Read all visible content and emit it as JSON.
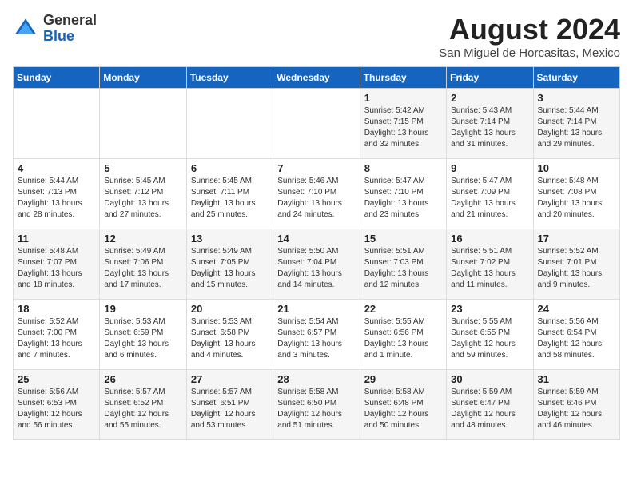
{
  "logo": {
    "general": "General",
    "blue": "Blue"
  },
  "header": {
    "month_year": "August 2024",
    "location": "San Miguel de Horcasitas, Mexico"
  },
  "days_of_week": [
    "Sunday",
    "Monday",
    "Tuesday",
    "Wednesday",
    "Thursday",
    "Friday",
    "Saturday"
  ],
  "weeks": [
    [
      {
        "day": "",
        "info": ""
      },
      {
        "day": "",
        "info": ""
      },
      {
        "day": "",
        "info": ""
      },
      {
        "day": "",
        "info": ""
      },
      {
        "day": "1",
        "info": "Sunrise: 5:42 AM\nSunset: 7:15 PM\nDaylight: 13 hours\nand 32 minutes."
      },
      {
        "day": "2",
        "info": "Sunrise: 5:43 AM\nSunset: 7:14 PM\nDaylight: 13 hours\nand 31 minutes."
      },
      {
        "day": "3",
        "info": "Sunrise: 5:44 AM\nSunset: 7:14 PM\nDaylight: 13 hours\nand 29 minutes."
      }
    ],
    [
      {
        "day": "4",
        "info": "Sunrise: 5:44 AM\nSunset: 7:13 PM\nDaylight: 13 hours\nand 28 minutes."
      },
      {
        "day": "5",
        "info": "Sunrise: 5:45 AM\nSunset: 7:12 PM\nDaylight: 13 hours\nand 27 minutes."
      },
      {
        "day": "6",
        "info": "Sunrise: 5:45 AM\nSunset: 7:11 PM\nDaylight: 13 hours\nand 25 minutes."
      },
      {
        "day": "7",
        "info": "Sunrise: 5:46 AM\nSunset: 7:10 PM\nDaylight: 13 hours\nand 24 minutes."
      },
      {
        "day": "8",
        "info": "Sunrise: 5:47 AM\nSunset: 7:10 PM\nDaylight: 13 hours\nand 23 minutes."
      },
      {
        "day": "9",
        "info": "Sunrise: 5:47 AM\nSunset: 7:09 PM\nDaylight: 13 hours\nand 21 minutes."
      },
      {
        "day": "10",
        "info": "Sunrise: 5:48 AM\nSunset: 7:08 PM\nDaylight: 13 hours\nand 20 minutes."
      }
    ],
    [
      {
        "day": "11",
        "info": "Sunrise: 5:48 AM\nSunset: 7:07 PM\nDaylight: 13 hours\nand 18 minutes."
      },
      {
        "day": "12",
        "info": "Sunrise: 5:49 AM\nSunset: 7:06 PM\nDaylight: 13 hours\nand 17 minutes."
      },
      {
        "day": "13",
        "info": "Sunrise: 5:49 AM\nSunset: 7:05 PM\nDaylight: 13 hours\nand 15 minutes."
      },
      {
        "day": "14",
        "info": "Sunrise: 5:50 AM\nSunset: 7:04 PM\nDaylight: 13 hours\nand 14 minutes."
      },
      {
        "day": "15",
        "info": "Sunrise: 5:51 AM\nSunset: 7:03 PM\nDaylight: 13 hours\nand 12 minutes."
      },
      {
        "day": "16",
        "info": "Sunrise: 5:51 AM\nSunset: 7:02 PM\nDaylight: 13 hours\nand 11 minutes."
      },
      {
        "day": "17",
        "info": "Sunrise: 5:52 AM\nSunset: 7:01 PM\nDaylight: 13 hours\nand 9 minutes."
      }
    ],
    [
      {
        "day": "18",
        "info": "Sunrise: 5:52 AM\nSunset: 7:00 PM\nDaylight: 13 hours\nand 7 minutes."
      },
      {
        "day": "19",
        "info": "Sunrise: 5:53 AM\nSunset: 6:59 PM\nDaylight: 13 hours\nand 6 minutes."
      },
      {
        "day": "20",
        "info": "Sunrise: 5:53 AM\nSunset: 6:58 PM\nDaylight: 13 hours\nand 4 minutes."
      },
      {
        "day": "21",
        "info": "Sunrise: 5:54 AM\nSunset: 6:57 PM\nDaylight: 13 hours\nand 3 minutes."
      },
      {
        "day": "22",
        "info": "Sunrise: 5:55 AM\nSunset: 6:56 PM\nDaylight: 13 hours\nand 1 minute."
      },
      {
        "day": "23",
        "info": "Sunrise: 5:55 AM\nSunset: 6:55 PM\nDaylight: 12 hours\nand 59 minutes."
      },
      {
        "day": "24",
        "info": "Sunrise: 5:56 AM\nSunset: 6:54 PM\nDaylight: 12 hours\nand 58 minutes."
      }
    ],
    [
      {
        "day": "25",
        "info": "Sunrise: 5:56 AM\nSunset: 6:53 PM\nDaylight: 12 hours\nand 56 minutes."
      },
      {
        "day": "26",
        "info": "Sunrise: 5:57 AM\nSunset: 6:52 PM\nDaylight: 12 hours\nand 55 minutes."
      },
      {
        "day": "27",
        "info": "Sunrise: 5:57 AM\nSunset: 6:51 PM\nDaylight: 12 hours\nand 53 minutes."
      },
      {
        "day": "28",
        "info": "Sunrise: 5:58 AM\nSunset: 6:50 PM\nDaylight: 12 hours\nand 51 minutes."
      },
      {
        "day": "29",
        "info": "Sunrise: 5:58 AM\nSunset: 6:48 PM\nDaylight: 12 hours\nand 50 minutes."
      },
      {
        "day": "30",
        "info": "Sunrise: 5:59 AM\nSunset: 6:47 PM\nDaylight: 12 hours\nand 48 minutes."
      },
      {
        "day": "31",
        "info": "Sunrise: 5:59 AM\nSunset: 6:46 PM\nDaylight: 12 hours\nand 46 minutes."
      }
    ]
  ]
}
